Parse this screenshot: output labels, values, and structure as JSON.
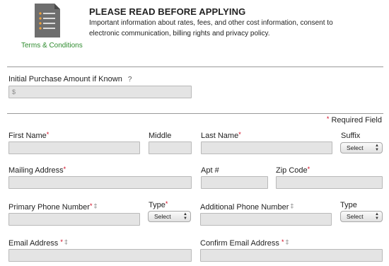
{
  "notice": {
    "terms_label": "Terms & Conditions",
    "title": "PLEASE READ BEFORE APPLYING",
    "body": "Important information about rates, fees, and other cost information, consent to electronic communication, billing rights and privacy policy."
  },
  "purchase": {
    "label": "Initial Purchase Amount if Known",
    "help": "?",
    "placeholder": "$"
  },
  "required_note": "Required Field",
  "required_marker": "*",
  "dagger_marker": "‡",
  "fields": {
    "first_name": "First Name",
    "middle": "Middle",
    "last_name": "Last Name",
    "suffix": "Suffix",
    "mailing_address": "Mailing Address",
    "apt": "Apt #",
    "zip": "Zip Code",
    "primary_phone": "Primary Phone Number",
    "type": "Type",
    "additional_phone": "Additional Phone Number",
    "type2": "Type",
    "email": "Email Address",
    "confirm_email": "Confirm Email Address"
  },
  "select_value": "Select",
  "colors": {
    "required": "#d0021b",
    "link": "#2e8b2e",
    "field_bg": "#e4e4e4"
  }
}
